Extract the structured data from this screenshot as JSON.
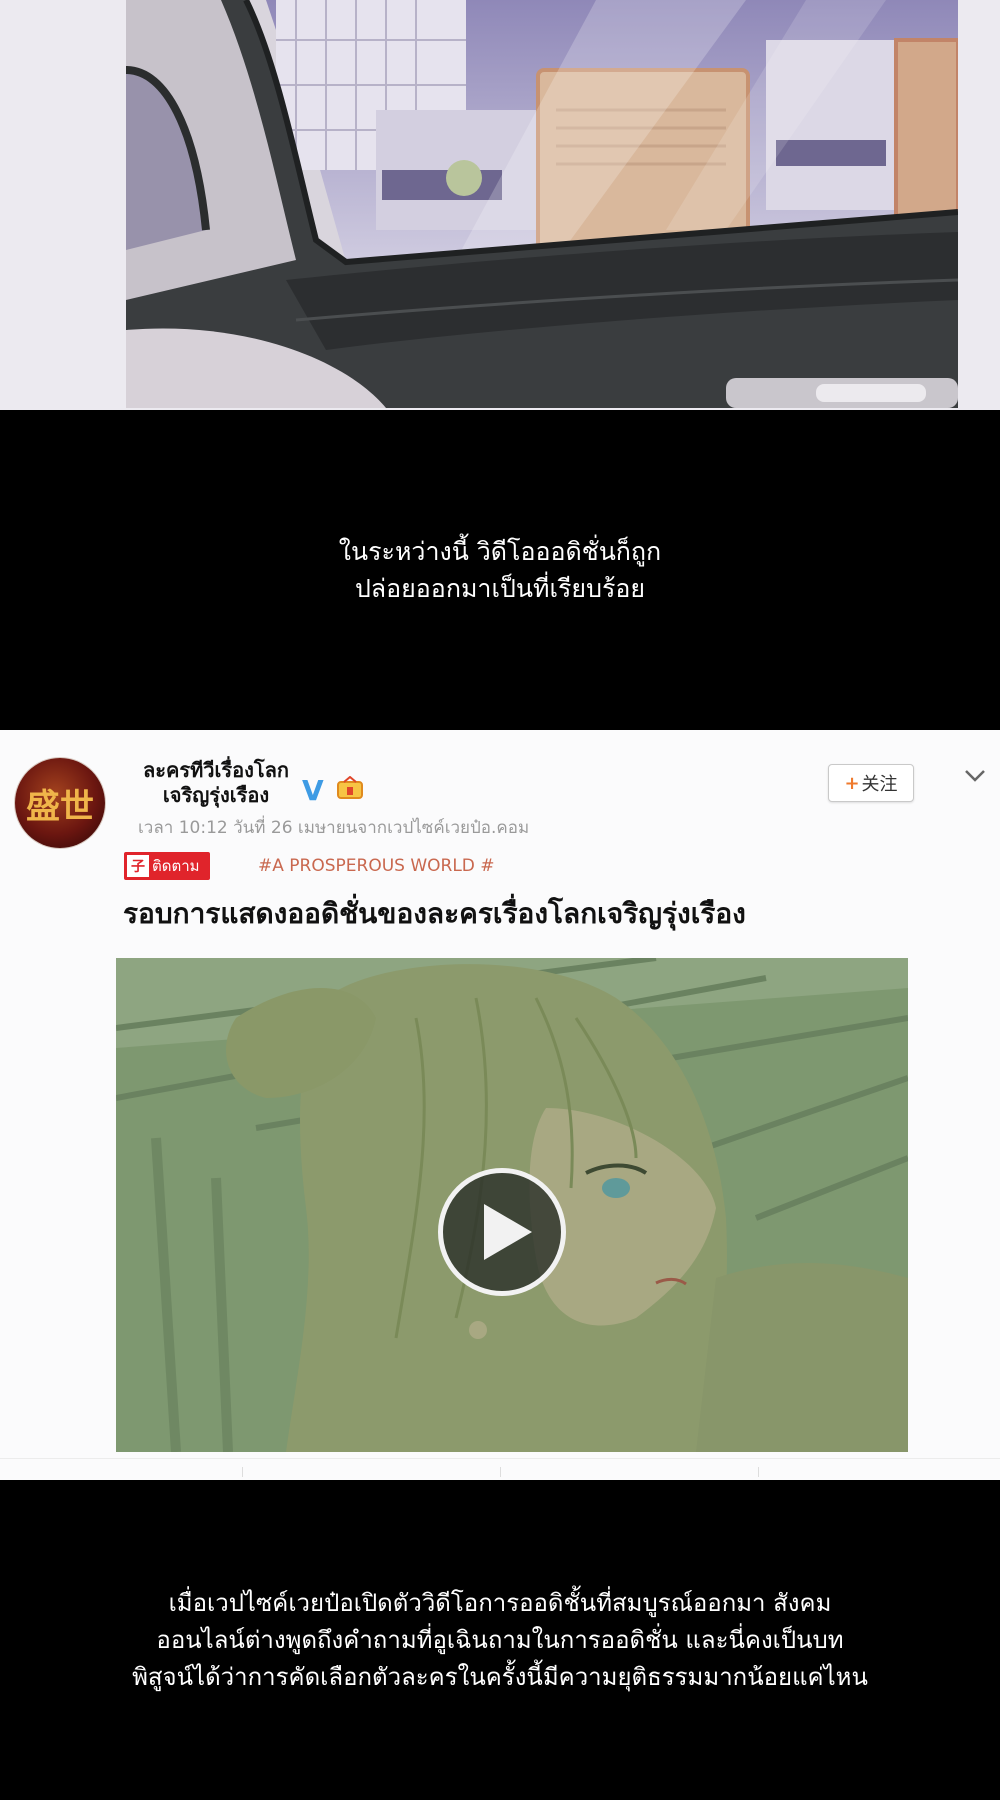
{
  "captions": {
    "first": "ในระหว่างนี้ วิดีโอออดิชั่นก็ถูก\nปล่อยออกมาเป็นที่เรียบร้อย",
    "second": "เมื่อเวปไซค์เวยป๋อเปิดตัววิดีโอการออดิชั้นที่สมบูรณ์ออกมา สังคม\nออนไลน์ต่างพูดถึงคำถามที่อูเฉินถามในการออดิชั่น และนี่คงเป็นบท\nพิสูจน์ได้ว่าการคัดเลือกตัวละครในครั้งนี้มีความยุติธรรมมากน้อยแค่ไหน"
  },
  "post": {
    "avatar_text": "盛世",
    "account_name": "ละครทีวีเรื่องโลก\nเจริญรุ่งเรือง",
    "verified_icon": "V",
    "rank_icon": "rank-badge-icon",
    "follow_button": {
      "plus": "+",
      "label": "关注"
    },
    "meta": "เวลา 10:12 วันที่ 26 เมษายนจากเวปไซค์เวยป๋อ.คอม",
    "follow_badge": {
      "icon": "子",
      "label": "ติดตาม"
    },
    "hashtag": "#A PROSPEROUS WORLD #",
    "title": "รอบการแสดงออดิชั่นของละครเรื่องโลกเจริญรุ่งเรือง",
    "video": {
      "play_icon": "play-icon"
    }
  },
  "colors": {
    "background": "#000000",
    "caption_text": "#ffffff",
    "verified": "#3e9be4",
    "follow_accent": "#ef7a2d",
    "badge_red": "#e0242b",
    "hashtag": "#c9684f"
  }
}
